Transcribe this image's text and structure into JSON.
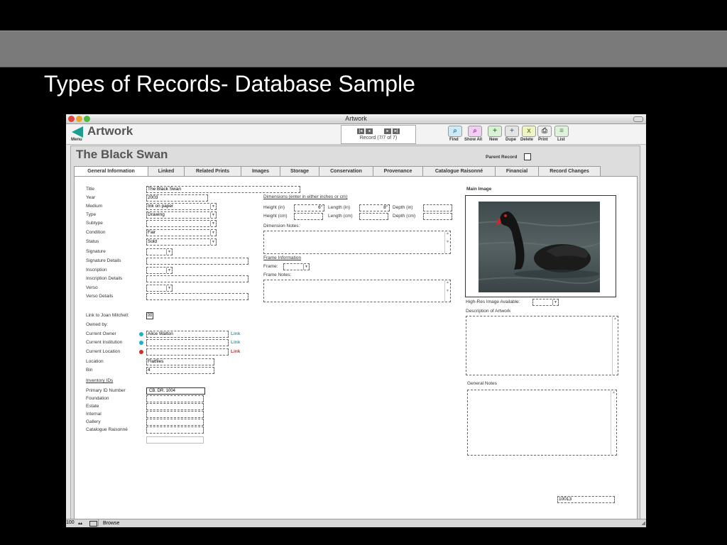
{
  "slide": {
    "title": "Types of Records- Database Sample"
  },
  "window": {
    "title": "Artwork"
  },
  "toolbar": {
    "app_name": "Artwork",
    "menu_label": "Menu",
    "record_status": "Record (7/7 of 7)",
    "buttons": [
      {
        "label": "Find",
        "icon": "search-icon",
        "glyph": "⌕"
      },
      {
        "label": "Show All",
        "icon": "search-all-icon",
        "glyph": "⌕"
      },
      {
        "label": "New",
        "icon": "plus-icon",
        "glyph": "+"
      },
      {
        "label": "Dupe",
        "icon": "duplicate-icon",
        "glyph": "+"
      },
      {
        "label": "Delete",
        "icon": "delete-icon",
        "glyph": "x"
      },
      {
        "label": "Print",
        "icon": "print-icon",
        "glyph": "⎙"
      },
      {
        "label": "List",
        "icon": "list-icon",
        "glyph": "≡"
      }
    ]
  },
  "record": {
    "title": "The Black Swan",
    "parent_record_label": "Parent Record"
  },
  "tabs": [
    "General Information",
    "Linked",
    "Related Prints",
    "Images",
    "Storage",
    "Conservation",
    "Provenance",
    "Catalogue Raisonné",
    "Financial",
    "Record Changes"
  ],
  "general": {
    "title_label": "Title",
    "title_value": "The Black Swan",
    "year_label": "Year",
    "year_value": "2003",
    "medium_label": "Medium",
    "medium_value": "Ink on paper",
    "type_label": "Type",
    "type_value": "Drawing",
    "subtype_label": "Subtype",
    "subtype_value": "",
    "condition_label": "Condition",
    "condition_value": "Fair",
    "status_label": "Status",
    "status_value": "Sold",
    "signature_label": "Signature",
    "signature_details_label": "Signature Details",
    "inscription_label": "Inscription",
    "inscription_details_label": "Inscription Details",
    "verso_label": "Verso",
    "verso_details_label": "Verso Details"
  },
  "dimensions": {
    "heading": "Dimensions (enter in either inches or cm)",
    "height_in_label": "Height (in)",
    "height_in_value": "6\"",
    "length_in_label": "Length (in)",
    "length_in_value": "8\"",
    "depth_in_label": "Depth (in)",
    "height_cm_label": "Height (cm)",
    "length_cm_label": "Length (cm)",
    "depth_cm_label": "Depth (cm)",
    "notes_label": "Dimension Notes:"
  },
  "frame": {
    "heading": "Frame Information",
    "frame_label": "Frame:",
    "notes_label": "Frame Notes:"
  },
  "links": {
    "link_to_label": "Link to Joan Mitchell:",
    "owned_by_label": "Owned by:",
    "current_owner_label": "Current Owner",
    "current_owner_value": "Alice Walton",
    "current_institution_label": "Current Institution",
    "current_location_label": "Current Location",
    "link_text": "Link",
    "location_label": "Location",
    "location_value": "Flatfiles",
    "bin_label": "Bin",
    "bin_value": "4"
  },
  "inventory": {
    "heading": "Inventory IDs",
    "primary_label": "Primary ID Number",
    "primary_value": "CB. DR. 1004",
    "foundation_label": "Foundation",
    "estate_label": "Estate",
    "internal_label": "Internal",
    "gallery_label": "Gallery",
    "catalogue_label": "Catalogue Raisonné"
  },
  "image": {
    "heading": "Main Image",
    "hires_label": "High-Res Image Available:",
    "description_label": "Description of Artwork",
    "general_notes_label": "General Notes"
  },
  "record_id": "10013",
  "statusbar": {
    "zoom": "100",
    "mode": "Browse"
  },
  "colors": {
    "teal": "#1a9e8f",
    "link_cyan": "#19b2c8",
    "link_red": "#d62b2b"
  }
}
